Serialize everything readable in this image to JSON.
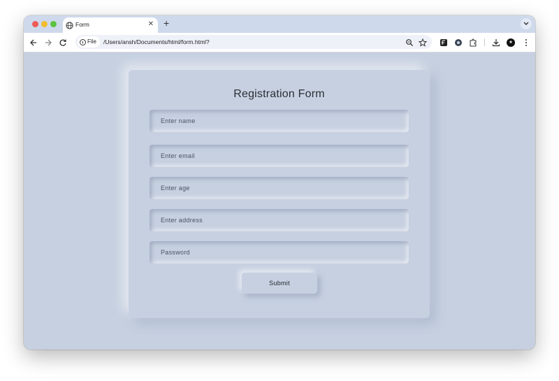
{
  "browser": {
    "tab": {
      "title": "Form"
    },
    "omnibox": {
      "chip_label": "File",
      "url": "/Users/ansh/Documents/html/form.html?"
    }
  },
  "form": {
    "title": "Registration Form",
    "fields": [
      {
        "placeholder": "Enter name",
        "value": ""
      },
      {
        "placeholder": "Enter email",
        "value": ""
      },
      {
        "placeholder": "Enter age",
        "value": ""
      },
      {
        "placeholder": "Enter address",
        "value": ""
      },
      {
        "placeholder": "Password",
        "value": ""
      }
    ],
    "submit_label": "Submit"
  },
  "colors": {
    "page_background": "#c6d0e0",
    "tabstrip": "#cfd9ec"
  },
  "icons": [
    "globe-icon",
    "close-icon",
    "plus-icon",
    "chevron-down-icon",
    "back-arrow-icon",
    "forward-arrow-icon",
    "reload-icon",
    "info-icon",
    "zoom-icon",
    "star-icon",
    "extension-icon",
    "puzzle-icon",
    "download-icon",
    "profile-icon",
    "kebab-menu-icon"
  ]
}
